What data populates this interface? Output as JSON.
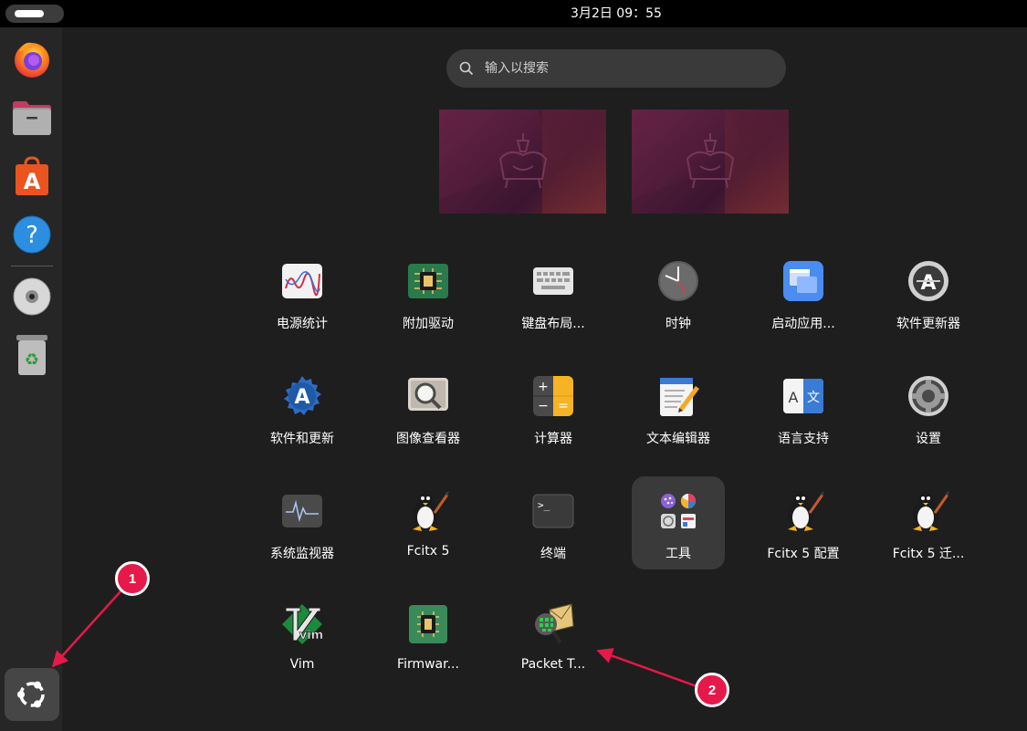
{
  "topbar": {
    "clock": "3月2日  09：55"
  },
  "dock": {
    "items": [
      {
        "name": "Firefox",
        "icon": "firefox-icon"
      },
      {
        "name": "Files",
        "icon": "files-icon"
      },
      {
        "name": "App Center",
        "icon": "app-center-icon"
      },
      {
        "name": "Help",
        "icon": "help-icon"
      },
      {
        "name": "CD Drive",
        "icon": "disc-icon"
      },
      {
        "name": "Trash",
        "icon": "trash-icon"
      }
    ],
    "show_apps_icon": "ubuntu-logo-icon"
  },
  "search": {
    "placeholder": "输入以搜索"
  },
  "workspaces": [
    {
      "icon": "ubuntu-wallpaper"
    },
    {
      "icon": "ubuntu-wallpaper"
    }
  ],
  "apps": [
    {
      "label": "电源统计",
      "icon": "power-statistics-icon"
    },
    {
      "label": "附加驱动",
      "icon": "additional-drivers-icon"
    },
    {
      "label": "键盘布局...",
      "icon": "keyboard-icon"
    },
    {
      "label": "时钟",
      "icon": "clock-icon"
    },
    {
      "label": "启动应用...",
      "icon": "startup-apps-icon"
    },
    {
      "label": "软件更新器",
      "icon": "software-updater-icon"
    },
    {
      "label": "软件和更新",
      "icon": "software-updates-icon"
    },
    {
      "label": "图像查看器",
      "icon": "image-viewer-icon"
    },
    {
      "label": "计算器",
      "icon": "calculator-icon"
    },
    {
      "label": "文本编辑器",
      "icon": "text-editor-icon"
    },
    {
      "label": "语言支持",
      "icon": "language-support-icon"
    },
    {
      "label": "设置",
      "icon": "settings-icon"
    },
    {
      "label": "系统监视器",
      "icon": "system-monitor-icon"
    },
    {
      "label": "Fcitx 5",
      "icon": "fcitx-penguin-icon"
    },
    {
      "label": "终端",
      "icon": "terminal-icon"
    },
    {
      "label": "工具",
      "icon": "utilities-folder-icon"
    },
    {
      "label": "Fcitx 5 配置",
      "icon": "fcitx-penguin-icon"
    },
    {
      "label": "Fcitx 5 迁...",
      "icon": "fcitx-penguin-icon"
    },
    {
      "label": "Vim",
      "icon": "vim-icon"
    },
    {
      "label": "Firmwar...",
      "icon": "firmware-icon"
    },
    {
      "label": "Packet T...",
      "icon": "packet-tracer-icon"
    }
  ],
  "annotations": {
    "badge1": "1",
    "badge2": "2",
    "color": "#e5194a"
  },
  "colors": {
    "background": "#1e1e1e",
    "topbar": "#000000",
    "dock": "#262626",
    "accent": "#e95420"
  }
}
